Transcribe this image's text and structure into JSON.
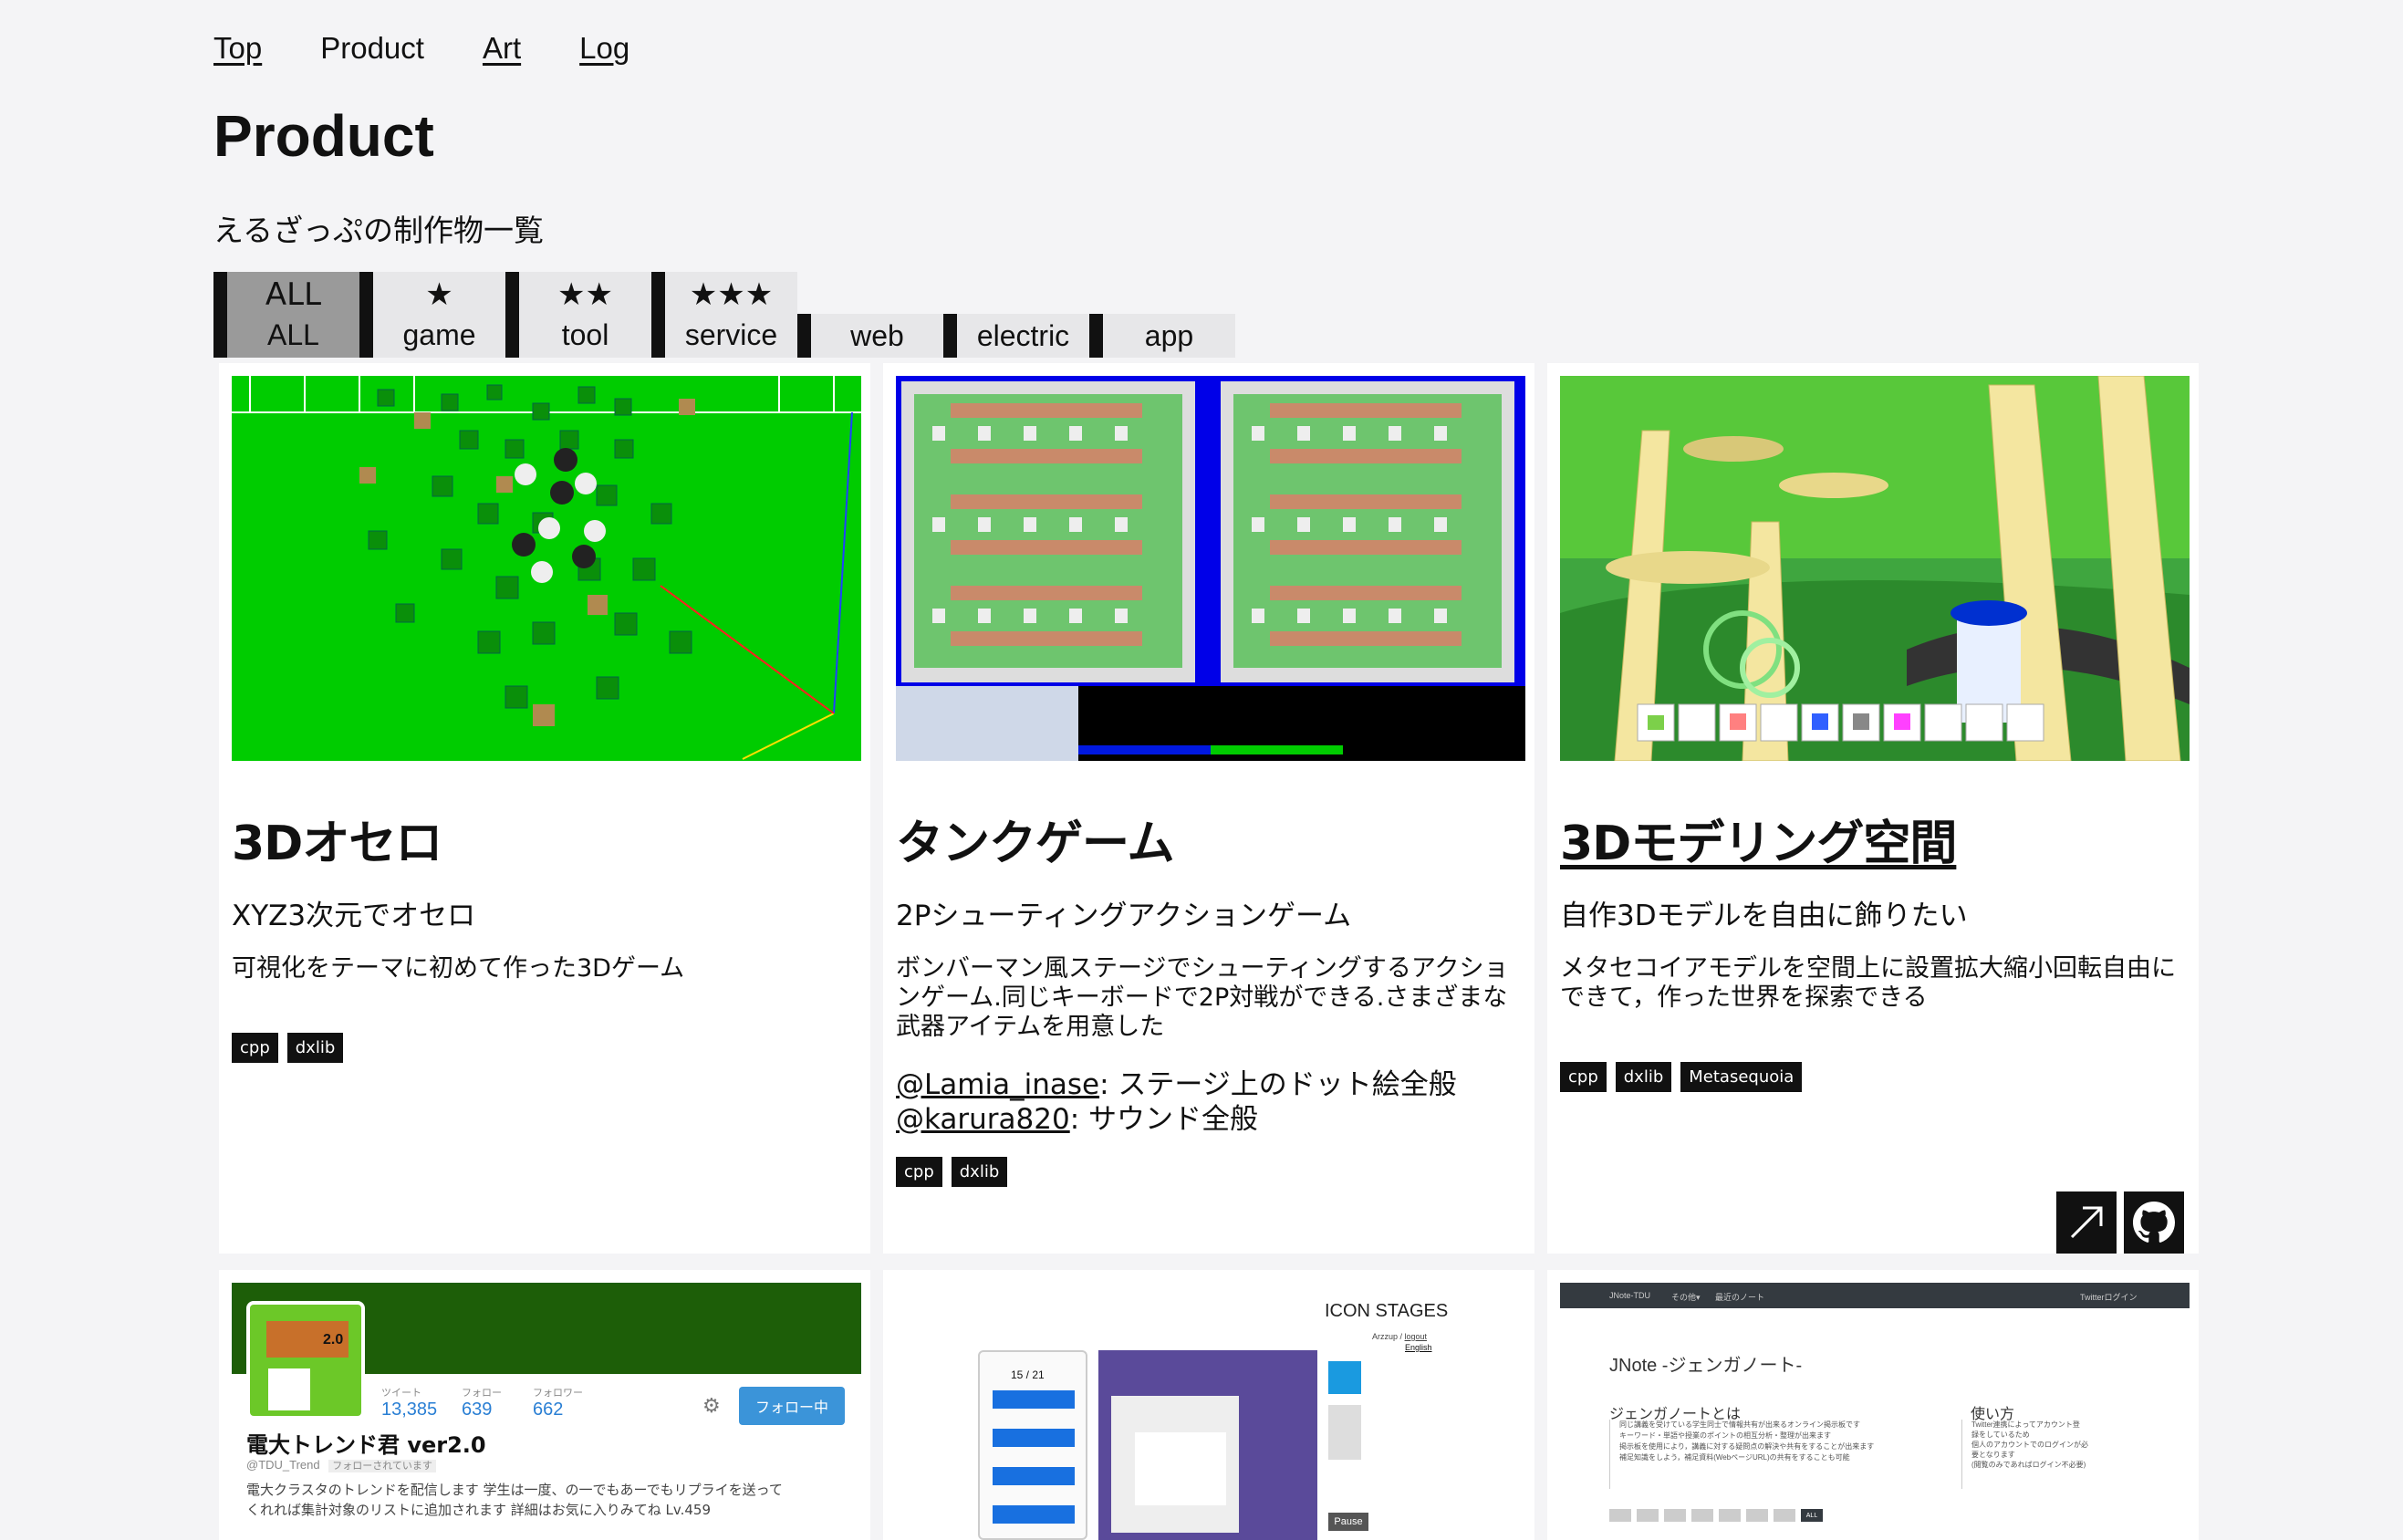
{
  "nav": {
    "top": "Top",
    "product": "Product",
    "art": "Art",
    "log": "Log"
  },
  "page": {
    "title": "Product",
    "subtitle": "えるざっぷの制作物一覧"
  },
  "filters": [
    {
      "stars": "ALL",
      "label": "ALL",
      "active": true
    },
    {
      "stars": "★",
      "label": "game"
    },
    {
      "stars": "★★",
      "label": "tool"
    },
    {
      "stars": "★★★",
      "label": "service"
    },
    {
      "label": "web"
    },
    {
      "label": "electric"
    },
    {
      "label": "app"
    }
  ],
  "cards": [
    {
      "title": "3Dオセロ",
      "tagline": "XYZ3次元でオセロ",
      "description": "可視化をテーマに初めて作った3Dゲーム",
      "tags": [
        "cpp",
        "dxlib"
      ]
    },
    {
      "title": "タンクゲーム",
      "tagline": "2Pシューティングアクションゲーム",
      "description": "ボンバーマン風ステージでシューティングするアクションゲーム.同じキーボードで2P対戦ができる.さまざまな武器アイテムを用意した",
      "credits": [
        {
          "handle": "@Lamia_inase",
          "role": ": ステージ上のドット絵全般"
        },
        {
          "handle": "@karura820",
          "role": ": サウンド全般"
        }
      ],
      "tags": [
        "cpp",
        "dxlib"
      ]
    },
    {
      "title": "3Dモデリング空間",
      "tagline": "自作3Dモデルを自由に飾りたい",
      "description": "メタセコイアモデルを空間上に設置拡大縮小回転自由にできて，作った世界を探索できる",
      "tags": [
        "cpp",
        "dxlib",
        "Metasequoia"
      ],
      "links": [
        "external-link-icon",
        "github-icon"
      ]
    }
  ],
  "bottom_cards": {
    "trend": {
      "badge": "2.0",
      "tweets_label": "ツイート",
      "tweets": "13,385",
      "following_label": "フォロー",
      "following": "639",
      "followers_label": "フォロワー",
      "followers": "662",
      "follow_button": "フォロー中",
      "name": "電大トレンド君 ver2.0",
      "handle": "@TDU_Trend",
      "handle_note": "フォローされています",
      "bio_line1": "電大クラスタのトレンドを配信します 学生は一度、の一でもあーでもリプライを送って",
      "bio_line2": "くれれば集計対象のリストに追加されます 詳細はお気に入りみてね Lv.459"
    },
    "icon_stages": {
      "title": "ICON STAGES",
      "user": "Arzzup /",
      "logout": "logout",
      "lang": "English",
      "counter": "15 / 21",
      "pause": "Pause"
    },
    "jnote": {
      "nav_brand": "JNote-TDU",
      "nav_other": "その他▾",
      "nav_recent": "最近のノート",
      "nav_login": "Twitterログイン",
      "heading": "JNote -ジェンガノート-",
      "about_title": "ジェンガノートとは",
      "about_1": "同じ講義を受けている学生同士で情報共有が出来るオンライン掲示板です",
      "about_2": "キーワード・単語や授業のポイントの相互分析・整理が出来ます",
      "about_3": "掲示板を使用により，講義に対する疑問点の解決や共有をすることが出来ます",
      "about_4": "補足知識をしよう，補足資料(WebページURL)の共有をすることも可能",
      "usage_title": "使い方",
      "usage_1": "Twitter連携によってアカウント登",
      "usage_2": "録をしているため",
      "usage_3": "個人のアカウントでのログインが必",
      "usage_4": "要となります",
      "usage_5": "(閲覧のみであればログイン不必要)",
      "all_btn": "ALL"
    }
  }
}
